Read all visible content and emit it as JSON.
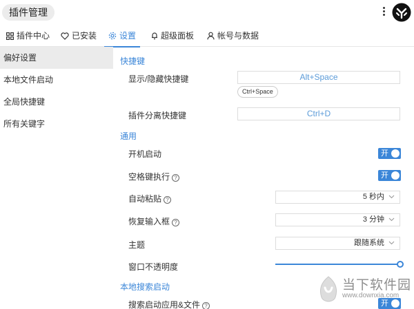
{
  "app": {
    "title": "插件管理"
  },
  "tabs": [
    {
      "label": "插件中心",
      "icon": "grid-icon"
    },
    {
      "label": "已安装",
      "icon": "heart-icon"
    },
    {
      "label": "设置",
      "icon": "gear-icon",
      "active": true
    },
    {
      "label": "超级面板",
      "icon": "bell-icon"
    },
    {
      "label": "帐号与数据",
      "icon": "user-icon"
    }
  ],
  "sidebar": {
    "items": [
      {
        "label": "偏好设置",
        "active": true
      },
      {
        "label": "本地文件启动"
      },
      {
        "label": "全局快捷键"
      },
      {
        "label": "所有关键字"
      }
    ]
  },
  "settings": {
    "shortcut_section": "快捷键",
    "show_hide": {
      "label": "显示/隐藏快捷键",
      "value": "Alt+Space",
      "chip": "Ctrl+Space"
    },
    "detach": {
      "label": "插件分离快捷键",
      "value": "Ctrl+D"
    },
    "general_section": "通用",
    "autostart": {
      "label": "开机启动",
      "toggle": "开"
    },
    "space_exec": {
      "label": "空格键执行",
      "toggle": "开"
    },
    "auto_paste": {
      "label": "自动粘贴",
      "value": "5 秒内"
    },
    "restore_input": {
      "label": "恢复输入框",
      "value": "3 分钟"
    },
    "theme": {
      "label": "主题",
      "value": "跟随系统"
    },
    "opacity": {
      "label": "窗口不透明度",
      "value_percent": 100
    },
    "local_search_section": "本地搜索启动",
    "search_apps": {
      "label": "搜索启动应用&文件",
      "toggle": "开"
    }
  },
  "watermark": {
    "text": "当下软件园",
    "url": "www.downxia.com"
  },
  "colors": {
    "accent": "#3b86d8"
  }
}
